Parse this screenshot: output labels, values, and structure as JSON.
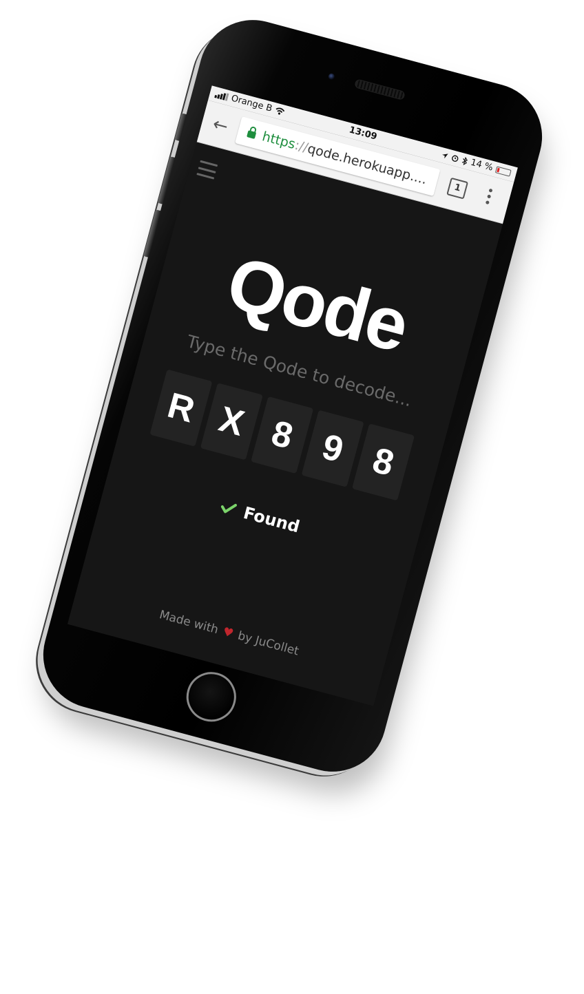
{
  "status_bar": {
    "carrier": "Orange B",
    "time": "13:09",
    "battery": "14 %"
  },
  "browser": {
    "url_scheme": "https",
    "url_separator": "://",
    "url_host": "qode.herokuapp....",
    "tab_count": "1"
  },
  "page": {
    "logo": "Qode",
    "subtitle": "Type the Qode to decode...",
    "code_chars": [
      "R",
      "X",
      "8",
      "9",
      "8"
    ],
    "status_text": "Found",
    "status_color": "#7bd36a",
    "footer_before": "Made with",
    "footer_after": "by JuCollet",
    "heart_color": "#c0262d"
  }
}
